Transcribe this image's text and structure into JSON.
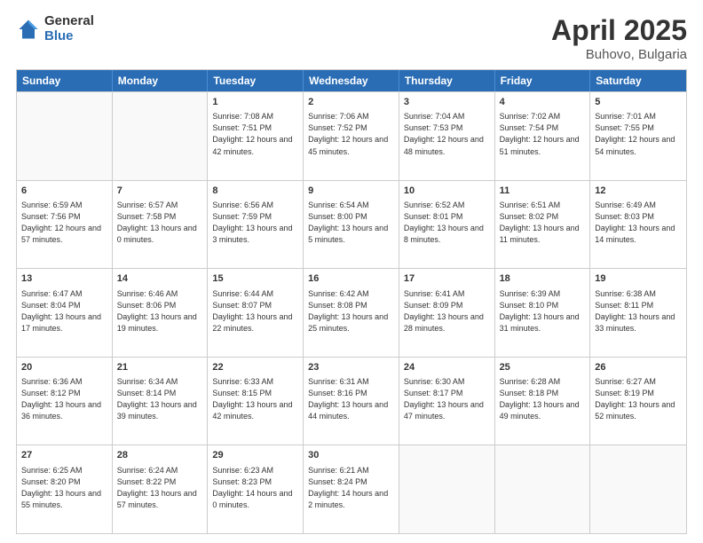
{
  "logo": {
    "general": "General",
    "blue": "Blue"
  },
  "title": {
    "month": "April 2025",
    "location": "Buhovo, Bulgaria"
  },
  "header": {
    "days": [
      "Sunday",
      "Monday",
      "Tuesday",
      "Wednesday",
      "Thursday",
      "Friday",
      "Saturday"
    ]
  },
  "rows": [
    [
      {
        "day": "",
        "info": ""
      },
      {
        "day": "",
        "info": ""
      },
      {
        "day": "1",
        "info": "Sunrise: 7:08 AM\nSunset: 7:51 PM\nDaylight: 12 hours and 42 minutes."
      },
      {
        "day": "2",
        "info": "Sunrise: 7:06 AM\nSunset: 7:52 PM\nDaylight: 12 hours and 45 minutes."
      },
      {
        "day": "3",
        "info": "Sunrise: 7:04 AM\nSunset: 7:53 PM\nDaylight: 12 hours and 48 minutes."
      },
      {
        "day": "4",
        "info": "Sunrise: 7:02 AM\nSunset: 7:54 PM\nDaylight: 12 hours and 51 minutes."
      },
      {
        "day": "5",
        "info": "Sunrise: 7:01 AM\nSunset: 7:55 PM\nDaylight: 12 hours and 54 minutes."
      }
    ],
    [
      {
        "day": "6",
        "info": "Sunrise: 6:59 AM\nSunset: 7:56 PM\nDaylight: 12 hours and 57 minutes."
      },
      {
        "day": "7",
        "info": "Sunrise: 6:57 AM\nSunset: 7:58 PM\nDaylight: 13 hours and 0 minutes."
      },
      {
        "day": "8",
        "info": "Sunrise: 6:56 AM\nSunset: 7:59 PM\nDaylight: 13 hours and 3 minutes."
      },
      {
        "day": "9",
        "info": "Sunrise: 6:54 AM\nSunset: 8:00 PM\nDaylight: 13 hours and 5 minutes."
      },
      {
        "day": "10",
        "info": "Sunrise: 6:52 AM\nSunset: 8:01 PM\nDaylight: 13 hours and 8 minutes."
      },
      {
        "day": "11",
        "info": "Sunrise: 6:51 AM\nSunset: 8:02 PM\nDaylight: 13 hours and 11 minutes."
      },
      {
        "day": "12",
        "info": "Sunrise: 6:49 AM\nSunset: 8:03 PM\nDaylight: 13 hours and 14 minutes."
      }
    ],
    [
      {
        "day": "13",
        "info": "Sunrise: 6:47 AM\nSunset: 8:04 PM\nDaylight: 13 hours and 17 minutes."
      },
      {
        "day": "14",
        "info": "Sunrise: 6:46 AM\nSunset: 8:06 PM\nDaylight: 13 hours and 19 minutes."
      },
      {
        "day": "15",
        "info": "Sunrise: 6:44 AM\nSunset: 8:07 PM\nDaylight: 13 hours and 22 minutes."
      },
      {
        "day": "16",
        "info": "Sunrise: 6:42 AM\nSunset: 8:08 PM\nDaylight: 13 hours and 25 minutes."
      },
      {
        "day": "17",
        "info": "Sunrise: 6:41 AM\nSunset: 8:09 PM\nDaylight: 13 hours and 28 minutes."
      },
      {
        "day": "18",
        "info": "Sunrise: 6:39 AM\nSunset: 8:10 PM\nDaylight: 13 hours and 31 minutes."
      },
      {
        "day": "19",
        "info": "Sunrise: 6:38 AM\nSunset: 8:11 PM\nDaylight: 13 hours and 33 minutes."
      }
    ],
    [
      {
        "day": "20",
        "info": "Sunrise: 6:36 AM\nSunset: 8:12 PM\nDaylight: 13 hours and 36 minutes."
      },
      {
        "day": "21",
        "info": "Sunrise: 6:34 AM\nSunset: 8:14 PM\nDaylight: 13 hours and 39 minutes."
      },
      {
        "day": "22",
        "info": "Sunrise: 6:33 AM\nSunset: 8:15 PM\nDaylight: 13 hours and 42 minutes."
      },
      {
        "day": "23",
        "info": "Sunrise: 6:31 AM\nSunset: 8:16 PM\nDaylight: 13 hours and 44 minutes."
      },
      {
        "day": "24",
        "info": "Sunrise: 6:30 AM\nSunset: 8:17 PM\nDaylight: 13 hours and 47 minutes."
      },
      {
        "day": "25",
        "info": "Sunrise: 6:28 AM\nSunset: 8:18 PM\nDaylight: 13 hours and 49 minutes."
      },
      {
        "day": "26",
        "info": "Sunrise: 6:27 AM\nSunset: 8:19 PM\nDaylight: 13 hours and 52 minutes."
      }
    ],
    [
      {
        "day": "27",
        "info": "Sunrise: 6:25 AM\nSunset: 8:20 PM\nDaylight: 13 hours and 55 minutes."
      },
      {
        "day": "28",
        "info": "Sunrise: 6:24 AM\nSunset: 8:22 PM\nDaylight: 13 hours and 57 minutes."
      },
      {
        "day": "29",
        "info": "Sunrise: 6:23 AM\nSunset: 8:23 PM\nDaylight: 14 hours and 0 minutes."
      },
      {
        "day": "30",
        "info": "Sunrise: 6:21 AM\nSunset: 8:24 PM\nDaylight: 14 hours and 2 minutes."
      },
      {
        "day": "",
        "info": ""
      },
      {
        "day": "",
        "info": ""
      },
      {
        "day": "",
        "info": ""
      }
    ]
  ]
}
